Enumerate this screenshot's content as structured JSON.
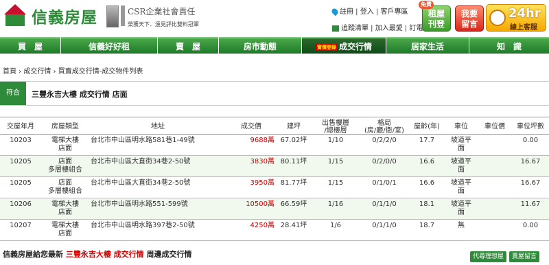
{
  "brand": {
    "name": "信義房屋",
    "accent": "#2e8b3a",
    "red": "#c8102e"
  },
  "csr": {
    "title": "CSR企業社會責任",
    "subtitle": "榮獲天下．遠見評比雙料冠軍"
  },
  "top_links": {
    "row1": [
      "註冊",
      "登入",
      "客戶專區"
    ],
    "row2": [
      "追蹤清單",
      "加入最愛",
      "訂電子報"
    ]
  },
  "header_buttons": {
    "rent": {
      "badge": "免費",
      "line1": "租屋",
      "line2": "刊登"
    },
    "message": {
      "line1": "我要",
      "line2": "留言"
    },
    "service": {
      "big": "24hr",
      "small": "線上客服"
    }
  },
  "nav": [
    {
      "label": "買　屋",
      "width": 0
    },
    {
      "label": "信義好好租"
    },
    {
      "label": "賣　屋"
    },
    {
      "label": "房市動態"
    },
    {
      "label": "成交行情",
      "tag": "實價登錄",
      "active": true
    },
    {
      "label": "居家生活"
    },
    {
      "label": "知　識"
    }
  ],
  "breadcrumb": "首頁 › 成交行情 › 買賣成交行情-成交物件列表",
  "section": {
    "tag": "符合",
    "title": "三豐永吉大樓 成交行情 店面"
  },
  "table": {
    "headers": [
      "交屋年月",
      "房屋類型",
      "地址",
      "成交價",
      "建坪",
      "出售樓層\n/總樓層",
      "格局\n(房/廳/衛/室)",
      "屋齡(年)",
      "車位",
      "車位價",
      "車位坪數"
    ],
    "rows": [
      {
        "date": "10203",
        "type1": "電梯大樓",
        "type2": "店面",
        "addr": "台北市中山區明水路581巷1-49號",
        "price": "9688",
        "unit": "萬",
        "area": "67.02坪",
        "floor": "1/10",
        "layout": "0/2/2/0",
        "age": "17.7",
        "park1": "坡道平",
        "park2": "面",
        "pprice": "",
        "ppp": "0.00"
      },
      {
        "date": "10205",
        "type1": "店面",
        "type2": "多層樓組合",
        "addr": "台北市中山區大直街34巷2-50號",
        "price": "3830",
        "unit": "萬",
        "area": "80.11坪",
        "floor": "1/15",
        "layout": "0/2/0/0",
        "age": "16.6",
        "park1": "坡道平",
        "park2": "面",
        "pprice": "",
        "ppp": "16.67"
      },
      {
        "date": "10205",
        "type1": "店面",
        "type2": "多層樓組合",
        "addr": "台北市中山區大直街34巷2-50號",
        "price": "3950",
        "unit": "萬",
        "area": "81.77坪",
        "floor": "1/15",
        "layout": "0/1/0/1",
        "age": "16.6",
        "park1": "坡道平",
        "park2": "面",
        "pprice": "",
        "ppp": "16.67"
      },
      {
        "date": "10206",
        "type1": "電梯大樓",
        "type2": "店面",
        "addr": "台北市中山區明水路551-599號",
        "price": "10500",
        "unit": "萬",
        "area": "66.59坪",
        "floor": "1/16",
        "layout": "0/1/1/0",
        "age": "18.1",
        "park1": "坡道平",
        "park2": "面",
        "pprice": "",
        "ppp": "11.67"
      },
      {
        "date": "10207",
        "type1": "電梯大樓",
        "type2": "店面",
        "addr": "台北市中山區明水路397巷2-50號",
        "price": "4250",
        "unit": "萬",
        "area": "28.41坪",
        "floor": "1/6",
        "layout": "0/1/1/0",
        "age": "18.7",
        "park1": "無",
        "park2": "",
        "pprice": "",
        "ppp": "0.00"
      }
    ]
  },
  "footer": {
    "prefix": "信義房屋給您最新 ",
    "highlight": "三豐永吉大樓 成交行情",
    "suffix": " 周邊成交行情",
    "btn_agent": "代尋理想屋",
    "btn_msg": "賣屋留言"
  }
}
